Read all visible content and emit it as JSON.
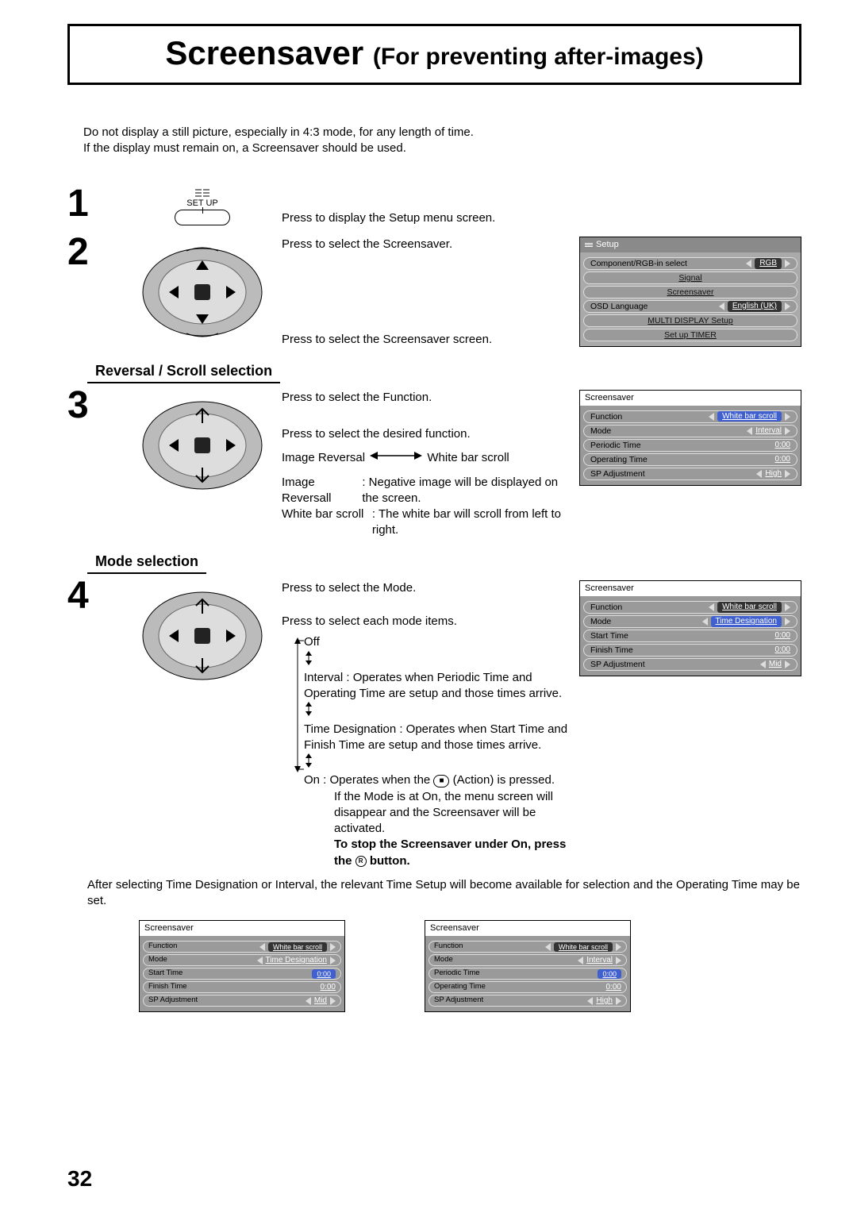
{
  "title": {
    "main": "Screensaver ",
    "sub": "(For preventing after-images)"
  },
  "intro": {
    "l1": "Do not display a still picture, especially in 4:3 mode, for any length of time.",
    "l2": "If the display must remain on, a Screensaver should be used."
  },
  "step1": {
    "setup_label": "SET UP",
    "text": "Press to display the Setup menu screen."
  },
  "step2": {
    "t1": "Press to select the Screensaver.",
    "t2": "Press to select the Screensaver screen.",
    "osd": {
      "title": "Setup",
      "row1": {
        "label": "Component/RGB-in  select",
        "val": "RGB"
      },
      "row2": "Signal",
      "row3": "Screensaver",
      "row4": {
        "label": "OSD  Language",
        "val": "English (UK)"
      },
      "row5": "MULTI DISPLAY Setup",
      "row6": "Set up TIMER"
    }
  },
  "section_rev": "Reversal / Scroll selection",
  "step3": {
    "t1": "Press to select the Function.",
    "t2": "Press to select the desired function.",
    "img_rev": "Image Reversal",
    "white_bar": "White bar scroll",
    "d1a": "Image Reversall",
    "d1b": ": Negative image will be displayed on the screen.",
    "d2a": "White bar scroll",
    "d2b": ": The white bar will scroll from left to right.",
    "osd": {
      "title": "Screensaver",
      "rows": {
        "r1": {
          "label": "Function",
          "val": "White bar scroll"
        },
        "r2": {
          "label": "Mode",
          "val": "Interval"
        },
        "r3": {
          "label": "Periodic Time",
          "val": "0:00"
        },
        "r4": {
          "label": "Operating Time",
          "val": "0:00"
        },
        "r5": {
          "label": "SP Adjustment",
          "val": "High"
        }
      }
    }
  },
  "section_mode": "Mode selection",
  "step4": {
    "t1": "Press to select the Mode.",
    "t2": "Press to select each mode items.",
    "m_off": "Off",
    "m_interval": "Interval : Operates when Periodic Time and Operating Time are setup and those times arrive.",
    "m_time_desig": "Time Designation : Operates when Start Time and Finish Time are setup and those times arrive.",
    "m_on_a": "On : Operates when the ",
    "m_on_b": " (Action) is pressed.",
    "m_on_note": "If the Mode is at On, the menu screen will disappear and the Screensaver will be activated.",
    "m_stop": "To stop the Screensaver under On, press the ",
    "m_stop2": " button.",
    "osd": {
      "title": "Screensaver",
      "rows": {
        "r1": {
          "label": "Function",
          "val": "White bar scroll"
        },
        "r2": {
          "label": "Mode",
          "val": "Time Designation"
        },
        "r3": {
          "label": "Start Time",
          "val": "0:00"
        },
        "r4": {
          "label": "Finish Time",
          "val": "0:00"
        },
        "r5": {
          "label": "SP Adjustment",
          "val": "Mid"
        }
      }
    }
  },
  "after_text": "After selecting Time Designation or Interval, the relevant Time Setup will become available for selection and the Operating Time may be set.",
  "bottom_osd1": {
    "title": "Screensaver",
    "r1": {
      "label": "Function",
      "val": "White bar scroll"
    },
    "r2": {
      "label": "Mode",
      "val": "Time Designation"
    },
    "r3": {
      "label": "Start Time",
      "val": "0:00"
    },
    "r4": {
      "label": "Finish Time",
      "val": "0:00"
    },
    "r5": {
      "label": "SP Adjustment",
      "val": "Mid"
    }
  },
  "bottom_osd2": {
    "title": "Screensaver",
    "r1": {
      "label": "Function",
      "val": "White bar scroll"
    },
    "r2": {
      "label": "Mode",
      "val": "Interval"
    },
    "r3": {
      "label": "Periodic Time",
      "val": "0:00"
    },
    "r4": {
      "label": "Operating Time",
      "val": "0:00"
    },
    "r5": {
      "label": "SP Adjustment",
      "val": "High"
    }
  },
  "page_number": "32"
}
